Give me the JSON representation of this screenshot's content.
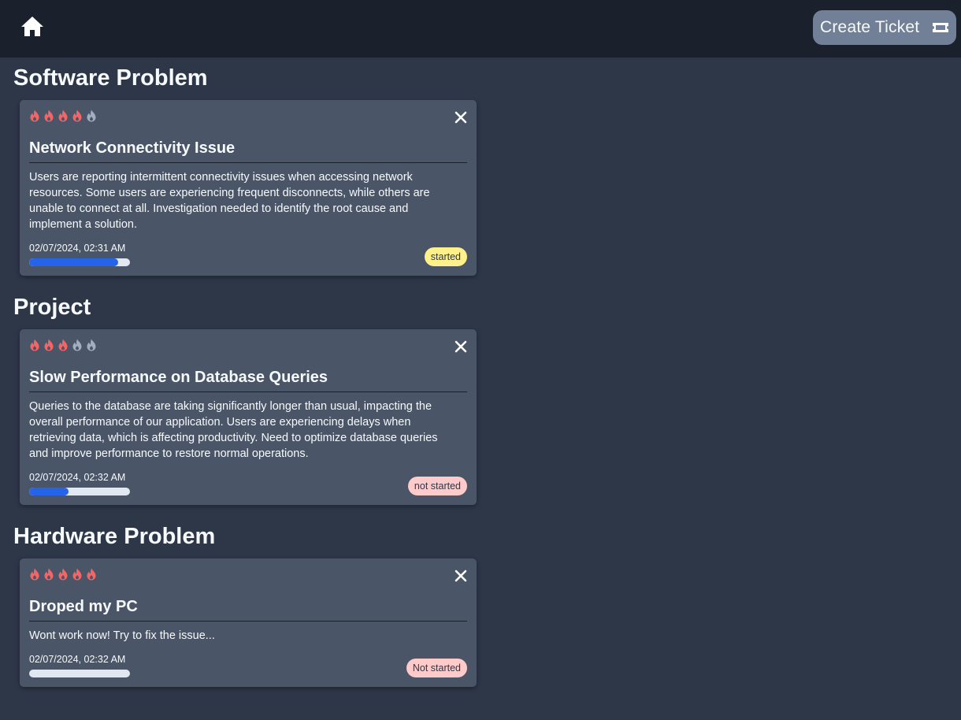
{
  "header": {
    "home_icon": "home-icon",
    "create_ticket_label": "Create Ticket",
    "create_ticket_icon": "ticket-icon"
  },
  "sections": [
    {
      "title": "Software Problem",
      "ticket": {
        "priority": 4,
        "priority_max": 5,
        "title": "Network Connectivity Issue",
        "description": "Users are reporting intermittent connectivity issues when accessing network resources. Some users are experiencing frequent disconnects, while others are unable to connect at all. Investigation needed to identify the root cause and implement a solution.",
        "date": "02/07/2024, 02:31 AM",
        "progress": 0.88,
        "status": "started",
        "status_color": "#fef08a"
      }
    },
    {
      "title": "Project",
      "ticket": {
        "priority": 3,
        "priority_max": 5,
        "title": "Slow Performance on Database Queries",
        "description": "Queries to the database are taking significantly longer than usual, impacting the overall performance of our application. Users are experiencing delays when retrieving data, which is affecting productivity. Need to optimize database queries and improve performance to restore normal operations.",
        "date": "02/07/2024, 02:32 AM",
        "progress": 0.39,
        "status": "not started",
        "status_color": "#fecaca"
      }
    },
    {
      "title": "Hardware Problem",
      "ticket": {
        "priority": 5,
        "priority_max": 5,
        "title": "Droped my PC",
        "description": "Wont work now! Try to fix the issue...",
        "date": "02/07/2024, 02:32 AM",
        "progress": 0,
        "status": "Not started",
        "status_color": "#fecaca"
      }
    }
  ],
  "colors": {
    "flame_active": "#f56565",
    "flame_inactive": "#a0aec0",
    "progress_fill": "#2563eb",
    "progress_track": "#e2e8f0",
    "card_bg": "#4a5568",
    "page_bg": "#2d3748",
    "header_bg": "#1a202c"
  }
}
